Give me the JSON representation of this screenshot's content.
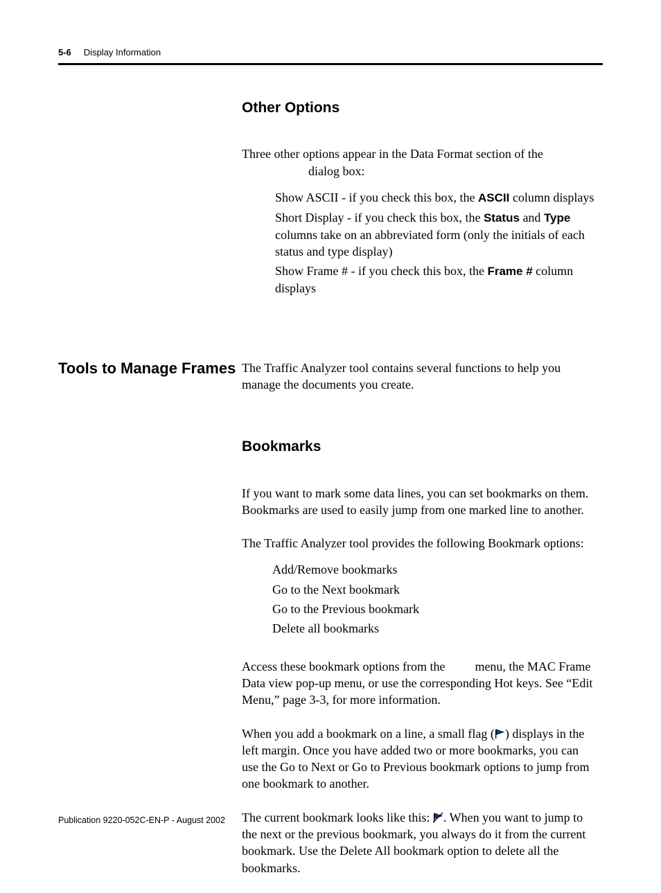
{
  "header": {
    "page_num": "5-6",
    "section": "Display Information"
  },
  "section1": {
    "heading": "Other Options",
    "intro_l1": "Three other options appear in the Data Format section of the",
    "intro_l2": "dialog box:",
    "opt1_pre": "Show ASCII - if you check this box, the ",
    "opt1_bold": "ASCII",
    "opt1_post": " column displays",
    "opt2_l1_pre": "Short Display - if you check this box, the ",
    "opt2_l1_b1": "Status",
    "opt2_l1_mid": " and ",
    "opt2_l1_b2": "Type",
    "opt2_l2": "columns take on an abbreviated form (only the initials of each",
    "opt2_l3": "status and type display)",
    "opt3_l1_pre": "Show Frame # - if you check this box, the ",
    "opt3_l1_bold": "Frame #",
    "opt3_l1_post": " column",
    "opt3_l2": "displays"
  },
  "section2": {
    "side_heading": "Tools to Manage Frames",
    "intro_l1": "The Traffic Analyzer tool contains several functions to help you",
    "intro_l2": "manage the documents you create."
  },
  "section3": {
    "heading": "Bookmarks",
    "p1_l1": "If you want to mark some data lines, you can set bookmarks on them.",
    "p1_l2": "Bookmarks are used to easily jump from one marked line to another.",
    "p2": "The Traffic Analyzer tool provides the following Bookmark options:",
    "opts": {
      "o1": "Add/Remove bookmarks",
      "o2": "Go to the Next bookmark",
      "o3": "Go to the Previous bookmark",
      "o4": "Delete all bookmarks"
    },
    "p3_l1_pre": "Access these bookmark options from the ",
    "p3_l1_post": " menu, the MAC Frame",
    "p3_l2": "Data view pop-up menu, or use the corresponding Hot keys. See “Edit",
    "p3_l3": "Menu,” page 3-3, for more information.",
    "p4_l1_pre": "When you add a bookmark on a line, a small flag (",
    "p4_l1_post": ") displays in the",
    "p4_l2": "left margin. Once you have added two or more bookmarks, you can",
    "p4_l3": "use the Go to Next or Go to Previous bookmark options to jump from",
    "p4_l4": "one bookmark to another.",
    "p5_l1_pre": "The current bookmark looks like this: ",
    "p5_l1_post": ". When you want to jump to",
    "p5_l2": "the next or the previous bookmark, you always do it from the current",
    "p5_l3": "bookmark. Use the Delete All bookmark option to delete all the",
    "p5_l4": "bookmarks."
  },
  "footer": "Publication 9220-052C-EN-P - August 2002"
}
